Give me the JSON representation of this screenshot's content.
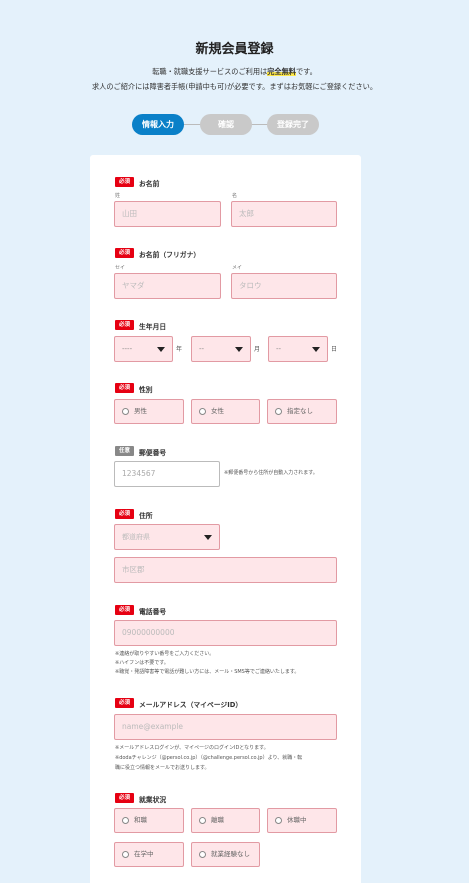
{
  "header": {
    "title": "新規会員登録",
    "intro_line1_pre": "転職・就職支援サービスのご利用は",
    "intro_line1_hl": "完全無料",
    "intro_line1_post": "です。",
    "intro_line2": "求人のご紹介には障害者手帳(申請中も可)が必要です。まずはお気軽にご登録ください。"
  },
  "steps": [
    "情報入力",
    "確認",
    "登録完了"
  ],
  "badges": {
    "required": "必須",
    "optional": "任意"
  },
  "name": {
    "label": "お名前",
    "sei_label": "姓",
    "mei_label": "名",
    "sei_placeholder": "山田",
    "mei_placeholder": "太郎"
  },
  "kana": {
    "label": "お名前（フリガナ）",
    "sei_label": "セイ",
    "mei_label": "メイ",
    "sei_placeholder": "ヤマダ",
    "mei_placeholder": "タロウ"
  },
  "birth": {
    "label": "生年月日",
    "year_value": "----",
    "month_value": "--",
    "day_value": "--",
    "year_unit": "年",
    "month_unit": "月",
    "day_unit": "日"
  },
  "gender": {
    "label": "性別",
    "options": [
      "男性",
      "女性",
      "指定なし"
    ]
  },
  "postal": {
    "label": "郵便番号",
    "placeholder": "1234567",
    "hint": "※郵便番号から住所が自動入力されます。"
  },
  "address": {
    "label": "住所",
    "pref_value": "都道府県",
    "city_placeholder": "市区郡"
  },
  "phone": {
    "label": "電話番号",
    "placeholder": "09000000000",
    "notes": [
      "※連絡が取りやすい番号をご入力ください。",
      "※ハイフンは不要です。",
      "※聴覚・発語障害等で電話が難しい方には、メール・SMS等でご連絡いたします。"
    ]
  },
  "email": {
    "label": "メールアドレス（マイページID）",
    "placeholder": "name@example",
    "notes": [
      "※メールアドレスログインが、マイページのログインIDとなります。",
      "※dodaチャレンジ（@persol.co.jp）（@challenge.persol.co.jp）より、就職・転",
      "職に役立つ情報をメールでお送りします。"
    ]
  },
  "employment": {
    "label": "就業状況",
    "options": [
      "和職",
      "離職",
      "休職中",
      "在学中",
      "就業経験なし"
    ]
  },
  "colors": {
    "accent": "#0a80c8",
    "required": "#e60012",
    "field_bg": "#fee6e9",
    "field_border": "#e29aa3",
    "page_bg": "#e4f1fb"
  }
}
